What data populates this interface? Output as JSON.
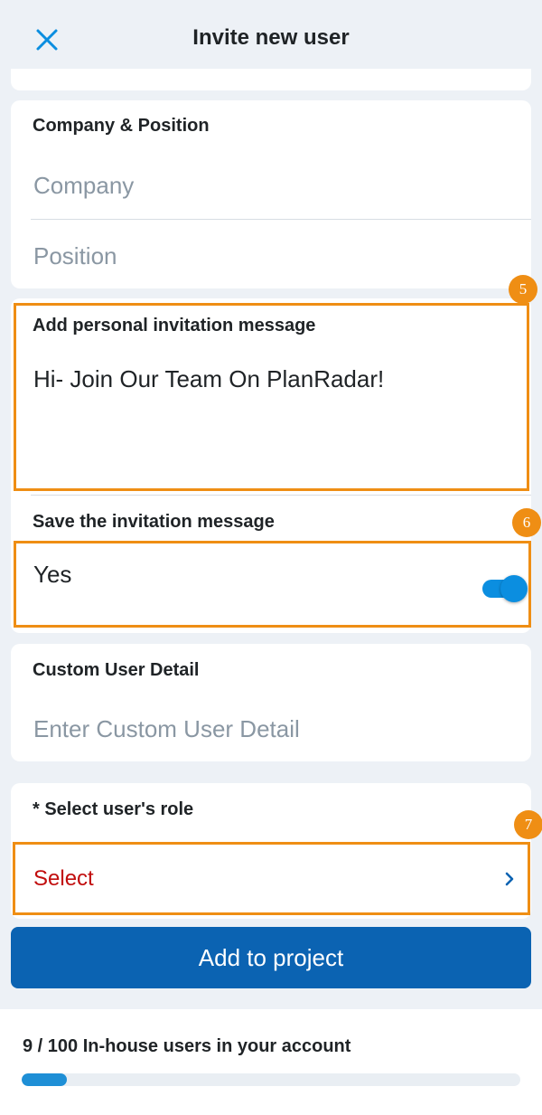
{
  "header": {
    "title": "Invite new user",
    "close_icon": "close-icon"
  },
  "company_section": {
    "label": "Company & Position",
    "company_placeholder": "Company",
    "position_placeholder": "Position"
  },
  "invite_section": {
    "label": "Add personal invitation message",
    "message": "Hi- Join Our Team On PlanRadar!",
    "save_label": "Save the invitation message",
    "save_value": "Yes",
    "save_toggle_on": true
  },
  "custom_section": {
    "label": "Custom User Detail",
    "placeholder": "Enter Custom User Detail"
  },
  "role_section": {
    "label": "* Select user's role",
    "select_value": "Select",
    "chevron_icon": "chevron-right-icon"
  },
  "badges": {
    "b5": "5",
    "b6": "6",
    "b7": "7"
  },
  "actions": {
    "add_to_project": "Add to project"
  },
  "footer": {
    "users_text": "9 / 100 In-house users in your account",
    "users_used": 9,
    "users_total": 100
  },
  "colors": {
    "accent": "#0b8ee0",
    "primary_button": "#0b63b2",
    "highlight": "#ef8e14",
    "error": "#c10d0d"
  }
}
